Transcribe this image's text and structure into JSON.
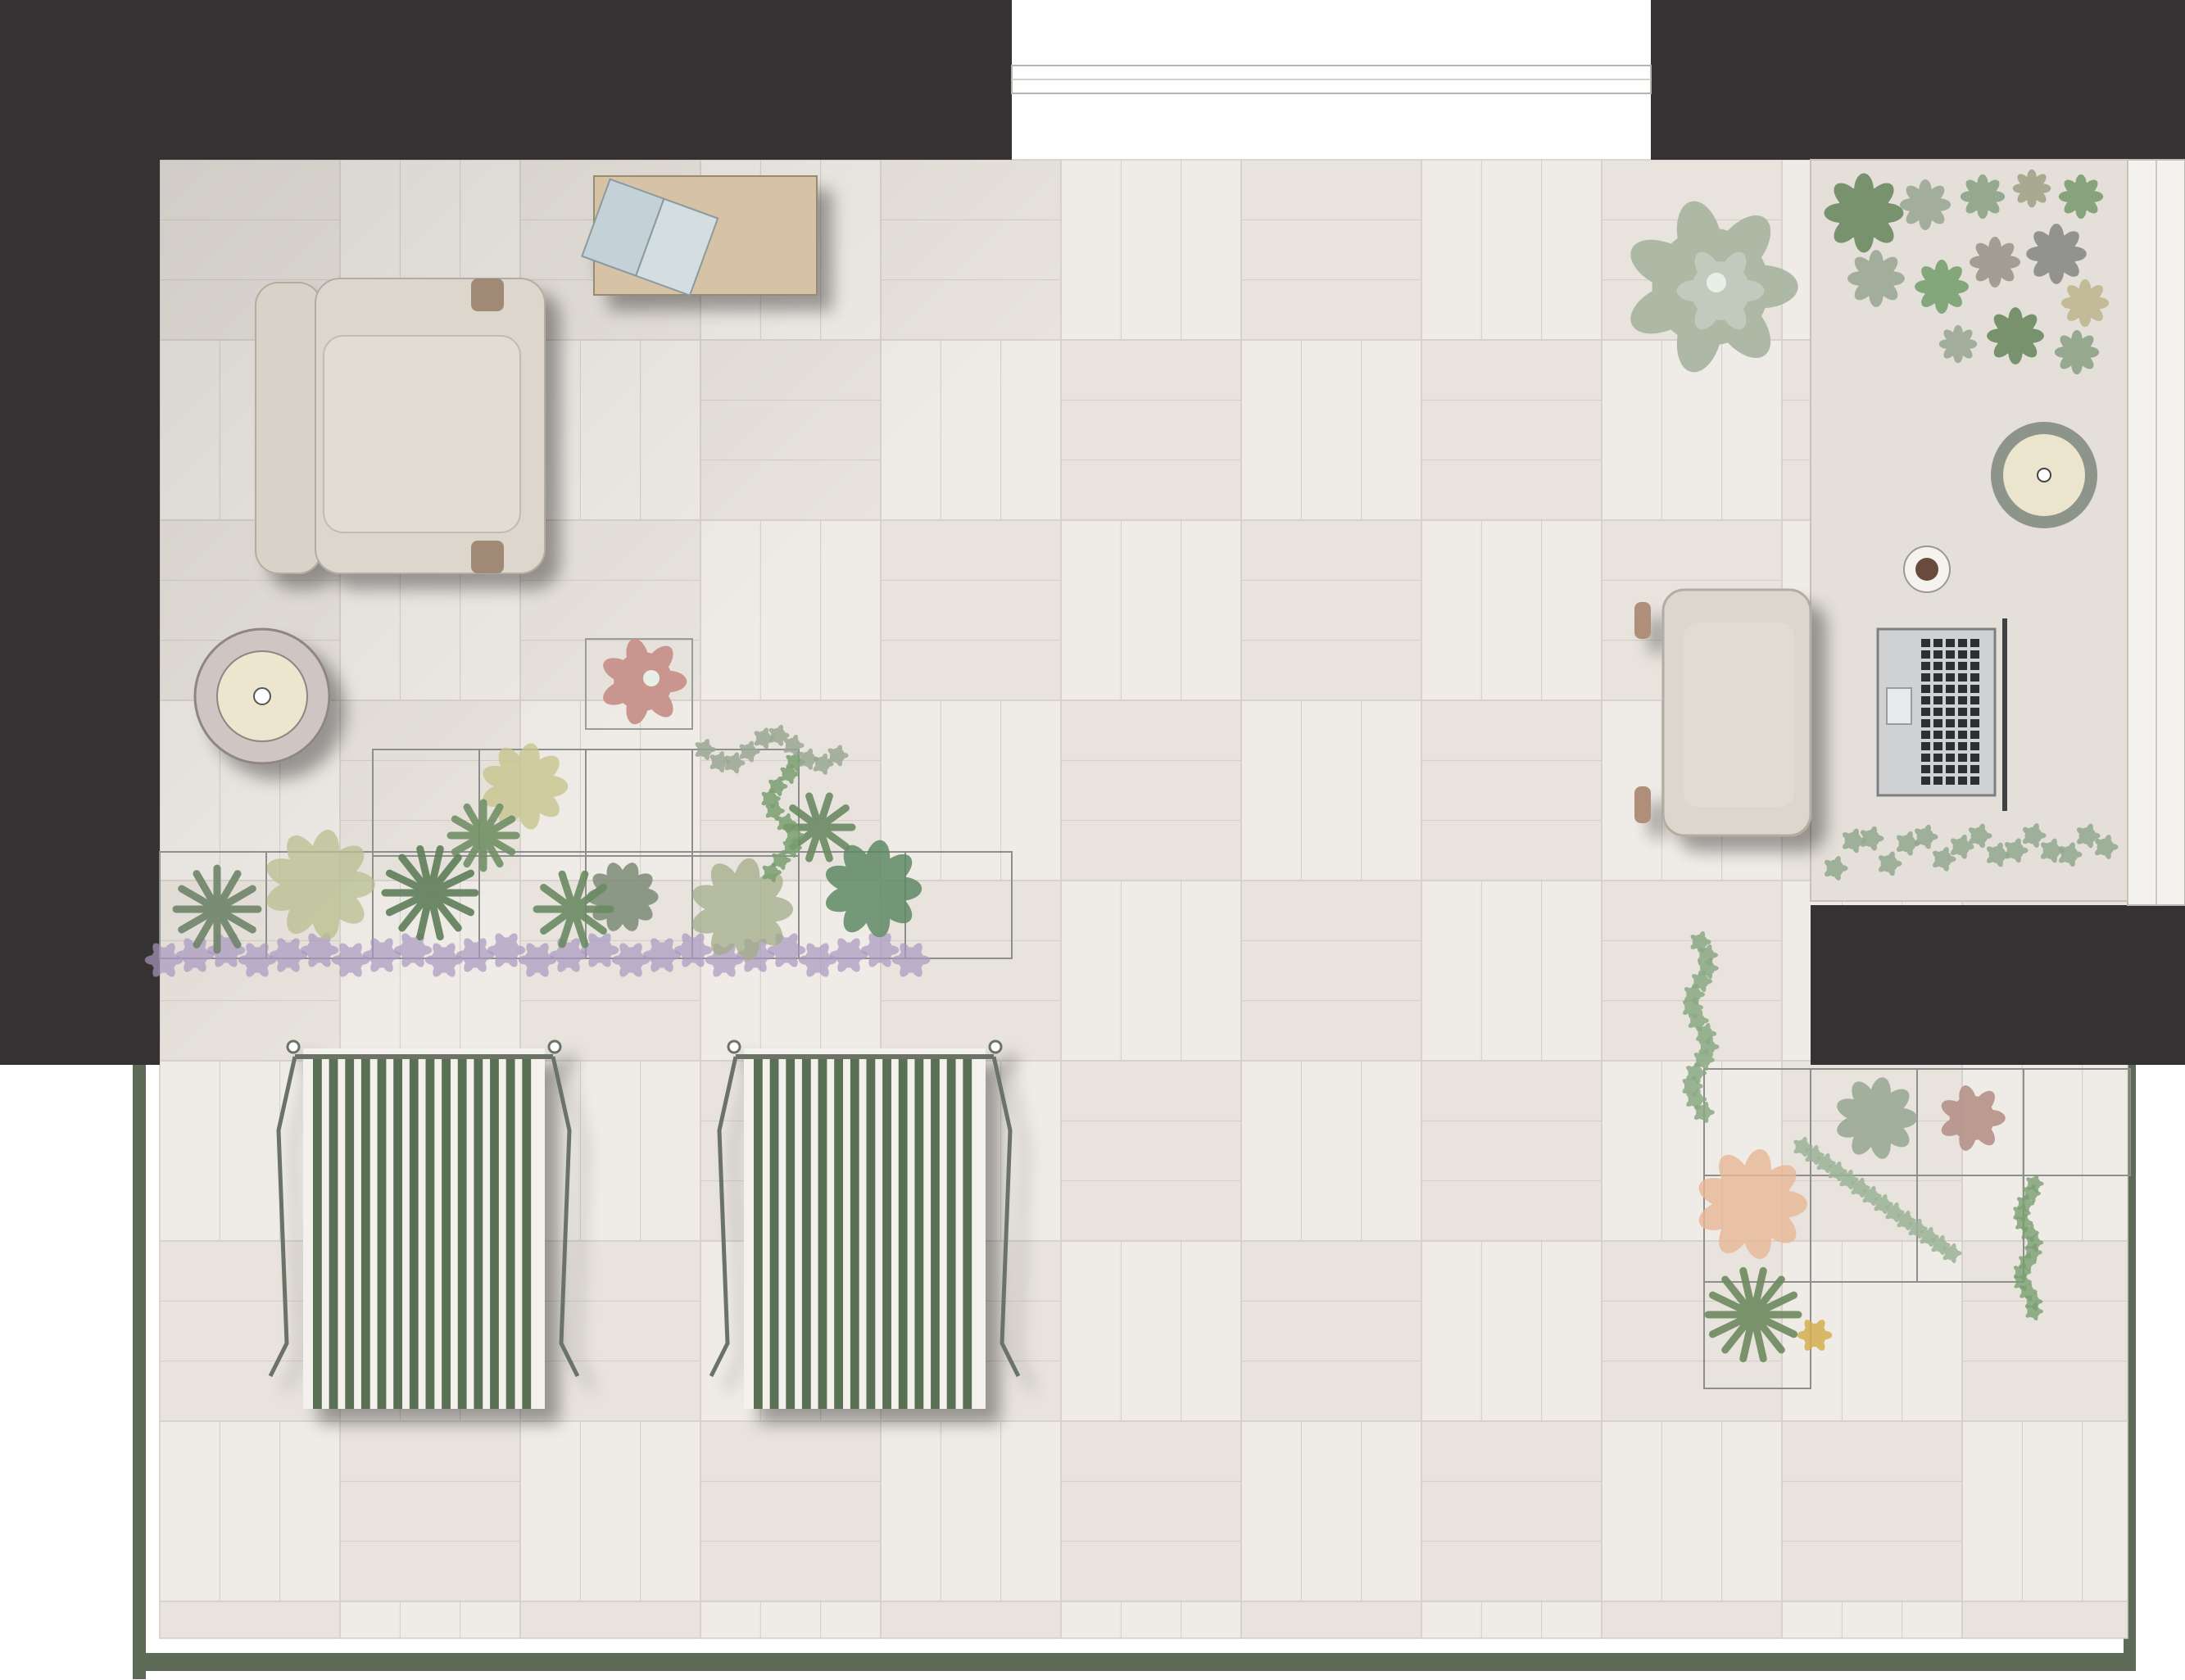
{
  "plan": {
    "kind": "top-down terrace floor plan",
    "text_labels": []
  },
  "colors": {
    "background": "#ffffff",
    "wall": "#353233",
    "floor_tile": "#efebe6",
    "floor_tile_alt": "#e8e3dd",
    "tile_seam": "#d3cdc6",
    "railing": "#5e6b58",
    "desk_stone": "#e6e1db",
    "wood": "#d6c2a4",
    "upholstery": "#dcd6cc",
    "planter_outline": "#8d8f8c",
    "lounger_slat": "#5a6f55",
    "foliage_dark": "#6b8a62",
    "foliage_light": "#b8c08f",
    "foliage_grey": "#9ba895",
    "succulent_pink": "#c8928b",
    "lavender": "#a998c0",
    "peach": "#e8b896"
  },
  "objects": [
    {
      "id": "wall-north-left",
      "type": "wall"
    },
    {
      "id": "wall-north-right",
      "type": "wall"
    },
    {
      "id": "wall-east",
      "type": "wall"
    },
    {
      "id": "wall-west",
      "type": "wall"
    },
    {
      "id": "door-opening",
      "type": "opening"
    },
    {
      "id": "railing",
      "type": "railing"
    },
    {
      "id": "armchair",
      "type": "lounge chair"
    },
    {
      "id": "side-table",
      "type": "round side table"
    },
    {
      "id": "coffee-table",
      "type": "wooden tray table with open book"
    },
    {
      "id": "planter-row",
      "type": "modular planter boxes"
    },
    {
      "id": "sun-lounger-left",
      "type": "slatted sun lounger"
    },
    {
      "id": "sun-lounger-right",
      "type": "slatted sun lounger"
    },
    {
      "id": "desk",
      "type": "stone desk with laptop and coffee cup"
    },
    {
      "id": "desk-chair",
      "type": "upholstered desk chair"
    },
    {
      "id": "corner-planter",
      "type": "stepped planter boxes"
    },
    {
      "id": "potted-succulent",
      "type": "large succulent"
    }
  ]
}
